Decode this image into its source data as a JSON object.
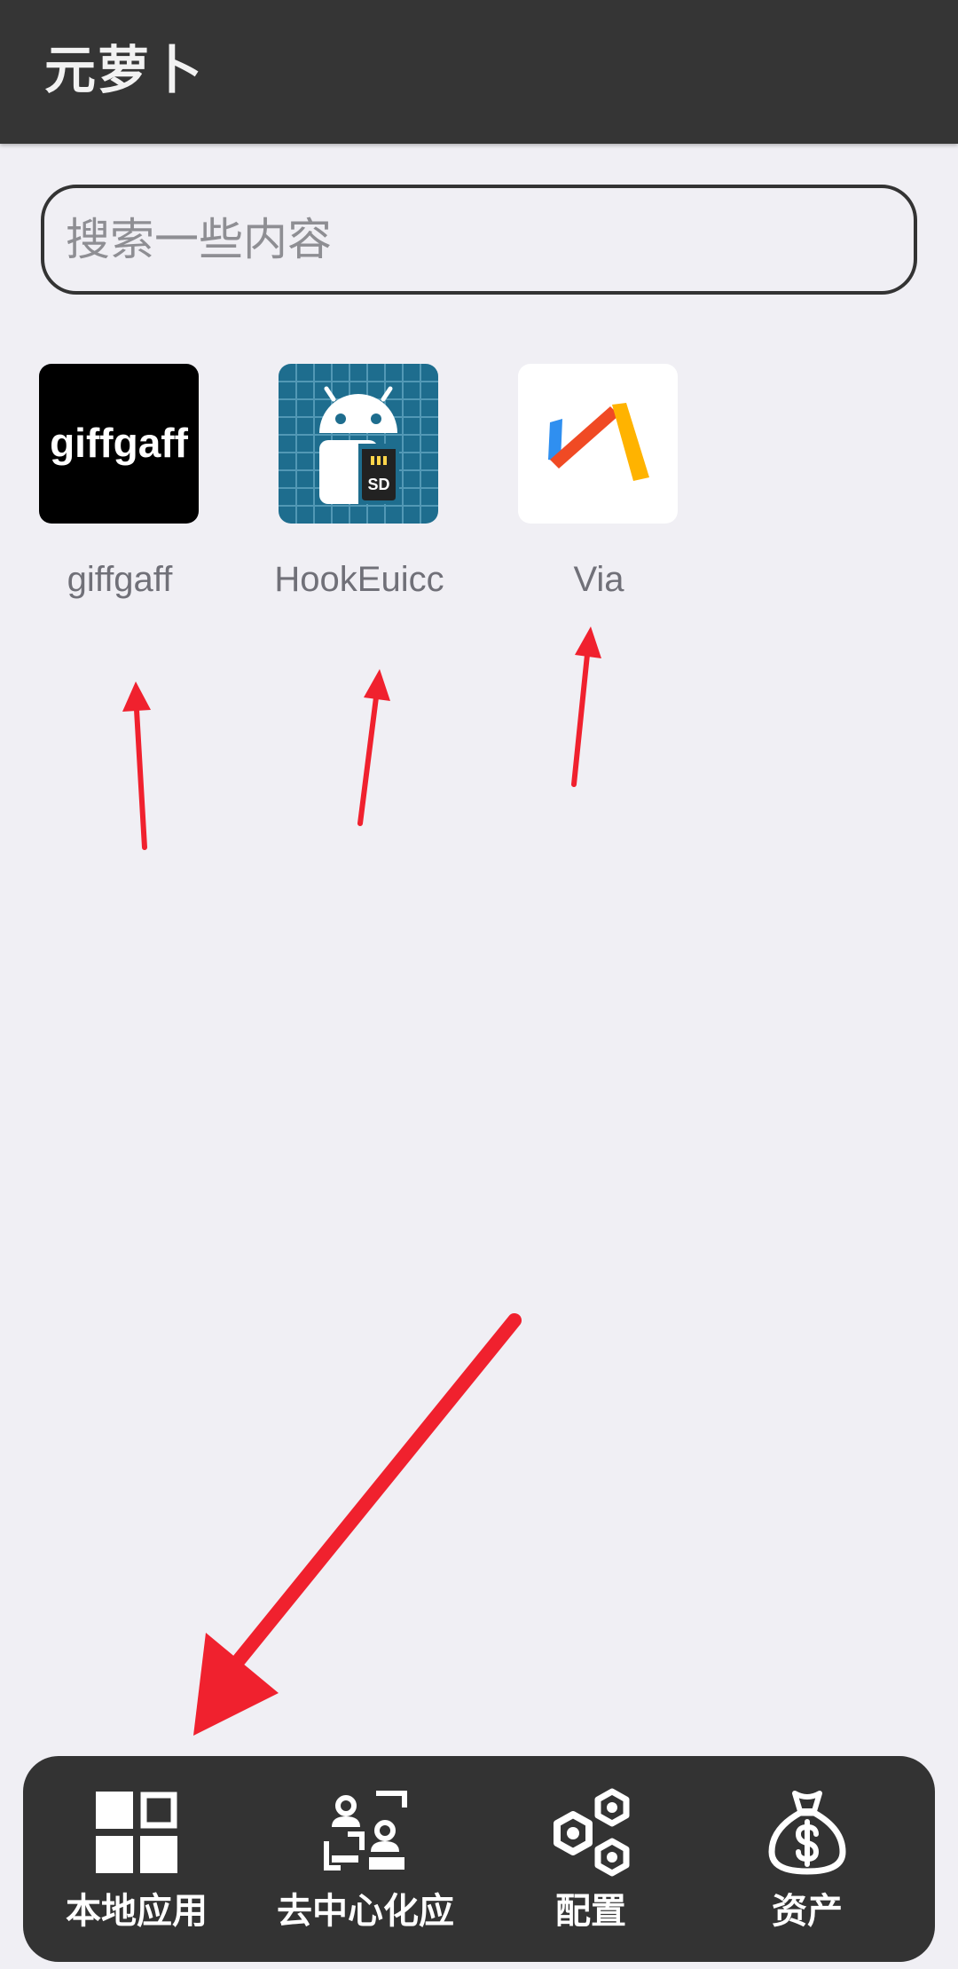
{
  "header": {
    "title": "元萝卜"
  },
  "search": {
    "placeholder": "搜索一些内容",
    "value": ""
  },
  "apps": [
    {
      "label": "giffgaff",
      "icon_text": "giffgaff",
      "icon": "giffgaff-logo-icon"
    },
    {
      "label": "HookEuicc",
      "icon_text": "SD",
      "icon": "android-sdcard-icon"
    },
    {
      "label": "Via",
      "icon": "via-browser-icon"
    }
  ],
  "bottom_nav": {
    "items": [
      {
        "label": "本地应用",
        "icon": "grid-icon"
      },
      {
        "label": "去中心化应",
        "icon": "scan-users-icon"
      },
      {
        "label": "配置",
        "icon": "hexagons-icon"
      },
      {
        "label": "资产",
        "icon": "money-bag-icon"
      }
    ]
  },
  "colors": {
    "header_bg": "#353535",
    "page_bg": "#f0eff4",
    "nav_bg": "#333333",
    "annotation_arrow": "#f0212e"
  }
}
